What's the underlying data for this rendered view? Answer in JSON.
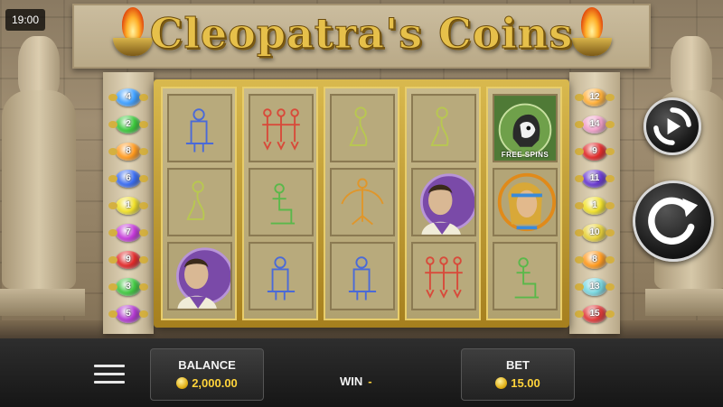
{
  "status": {
    "time": "19:00"
  },
  "game": {
    "title": "Cleopatra's Coins"
  },
  "reels": [
    [
      {
        "symbol": "seated-pharaoh",
        "style": "outline"
      },
      {
        "symbol": "kneeling-woman",
        "style": "outline"
      },
      {
        "symbol": "roman-emperor",
        "style": "full"
      }
    ],
    [
      {
        "symbol": "three-dancers",
        "style": "outline"
      },
      {
        "symbol": "sitting-figure",
        "style": "outline"
      },
      {
        "symbol": "seated-pharaoh",
        "style": "outline"
      }
    ],
    [
      {
        "symbol": "kneeling-woman",
        "style": "outline"
      },
      {
        "symbol": "sky-goddess",
        "style": "outline"
      },
      {
        "symbol": "seated-pharaoh",
        "style": "outline"
      }
    ],
    [
      {
        "symbol": "kneeling-woman",
        "style": "outline"
      },
      {
        "symbol": "roman-emperor",
        "style": "full"
      },
      {
        "symbol": "three-dancers",
        "style": "outline"
      }
    ],
    [
      {
        "symbol": "free-spins-scatter",
        "style": "full",
        "label": "FREE SPINS"
      },
      {
        "symbol": "cleopatra",
        "style": "full"
      },
      {
        "symbol": "sitting-figure",
        "style": "outline"
      }
    ]
  ],
  "paylines": {
    "left": [
      {
        "number": "4",
        "color": "#3fa0ff"
      },
      {
        "number": "2",
        "color": "#3cc83c"
      },
      {
        "number": "8",
        "color": "#ff9a1f"
      },
      {
        "number": "6",
        "color": "#3a6cf0"
      },
      {
        "number": "1",
        "color": "#f0e02a"
      },
      {
        "number": "7",
        "color": "#c43ad8"
      },
      {
        "number": "9",
        "color": "#e02a2a"
      },
      {
        "number": "3",
        "color": "#42c842"
      },
      {
        "number": "5",
        "color": "#b23ad0"
      }
    ],
    "right": [
      {
        "number": "12",
        "color": "#ffb03a"
      },
      {
        "number": "14",
        "color": "#f0a0c8"
      },
      {
        "number": "9",
        "color": "#e02a2a"
      },
      {
        "number": "11",
        "color": "#6a3ad0"
      },
      {
        "number": "1",
        "color": "#f0e02a"
      },
      {
        "number": "10",
        "color": "#e8d23a"
      },
      {
        "number": "8",
        "color": "#ff9a1f"
      },
      {
        "number": "13",
        "color": "#7ad8e0"
      },
      {
        "number": "15",
        "color": "#e03a3a"
      }
    ]
  },
  "controls": {
    "autoplay_icon": "autoplay-icon",
    "spin_icon": "spin-icon",
    "menu_icon": "menu-icon"
  },
  "balance": {
    "label": "BALANCE",
    "value": "2,000.00"
  },
  "win": {
    "label": "WIN",
    "value": "-"
  },
  "bet": {
    "label": "BET",
    "value": "15.00"
  }
}
